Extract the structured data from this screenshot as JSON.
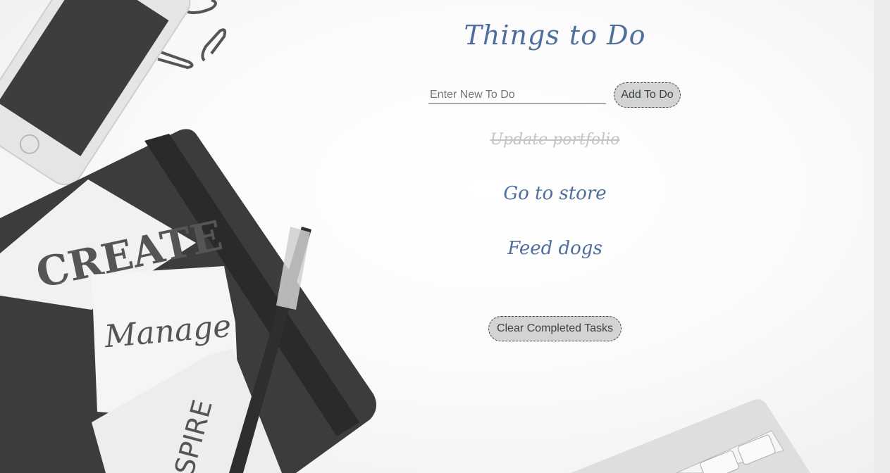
{
  "app": {
    "title": "Things to Do",
    "new_todo_placeholder": "Enter New To Do",
    "add_button_label": "Add To Do",
    "clear_button_label": "Clear Completed Tasks",
    "todos": [
      {
        "text": "Update portfolio",
        "completed": true
      },
      {
        "text": "Go to store",
        "completed": false
      },
      {
        "text": "Feed dogs",
        "completed": false
      }
    ]
  },
  "background": {
    "notes": [
      "CREATE",
      "Manage",
      "SPIRE"
    ]
  },
  "colors": {
    "accent": "#4e6f9e",
    "completed": "#c4c4c4",
    "button_bg": "#d3d3d3"
  }
}
